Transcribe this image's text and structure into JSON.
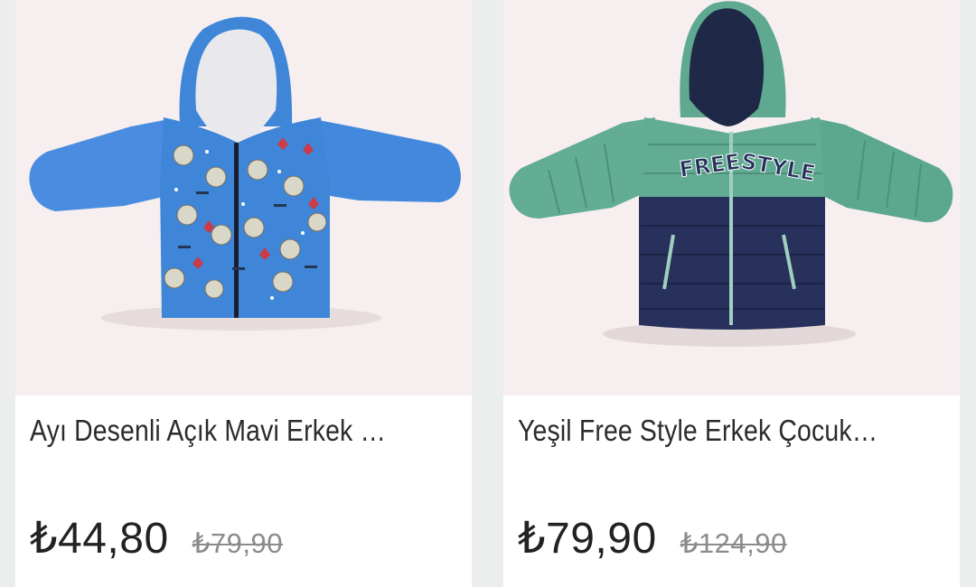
{
  "products": [
    {
      "title": "Ayı Desenli Açık Mavi Erkek Çocuk Mont",
      "price": "₺44,80",
      "old_price": "₺79,90",
      "image_icon": "blue-bear-hooded-jacket-image"
    },
    {
      "title": "Yeşil Free Style Erkek Çocuk Mont",
      "price": "₺79,90",
      "old_price": "₺124,90",
      "image_icon": "green-navy-puffer-jacket-image",
      "print_text": "FREE STYLE"
    }
  ],
  "colors": {
    "page_bg": "#eceeee",
    "image_bg": "#f6eeef",
    "blue_jacket": "#3f86d8",
    "green_jacket": "#5faa92",
    "navy_jacket": "#27315c"
  }
}
